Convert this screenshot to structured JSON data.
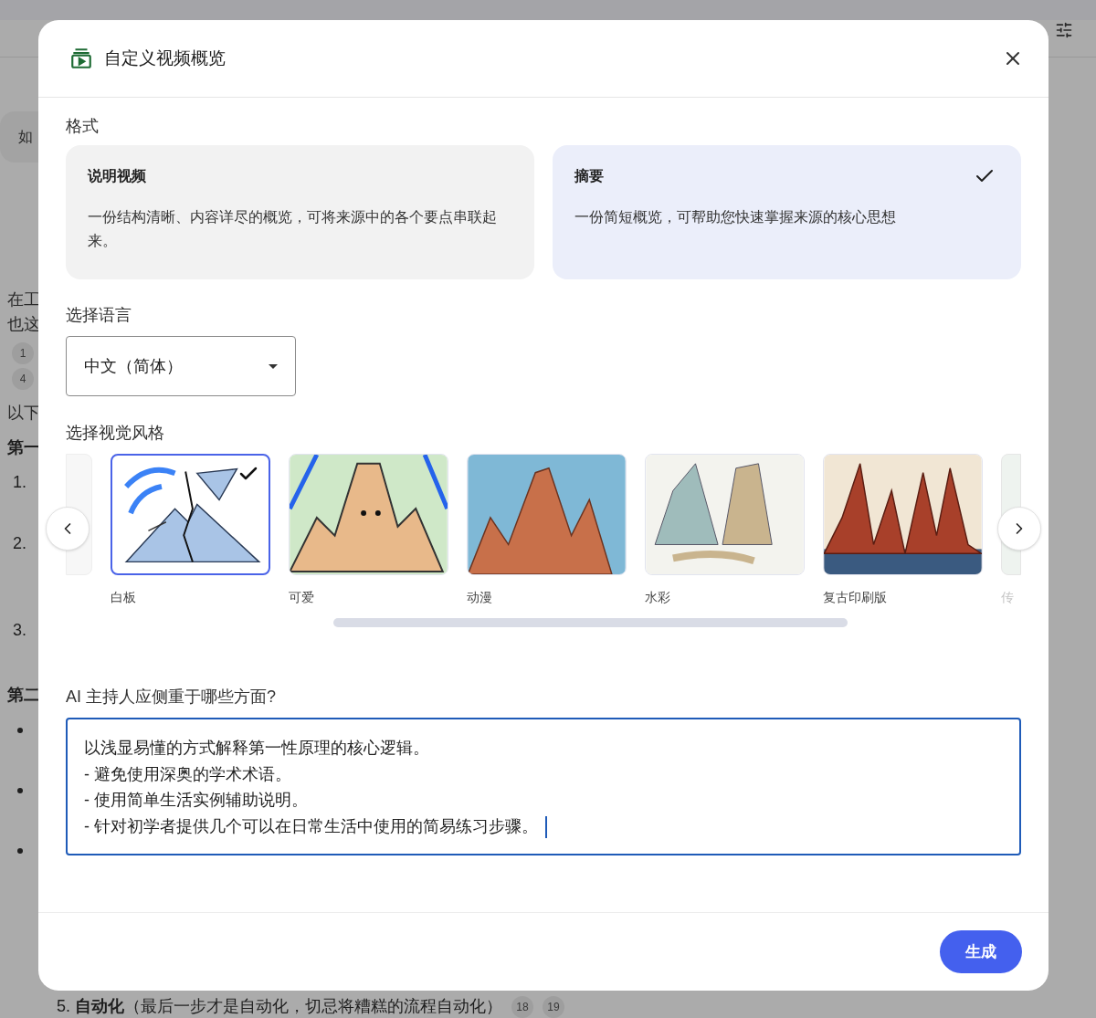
{
  "background_page": {
    "fragments": [
      {
        "kind": "bubble",
        "text": "如"
      },
      {
        "kind": "text",
        "text": "在工"
      },
      {
        "kind": "text",
        "text": "也这"
      },
      {
        "kind": "badge",
        "text": "1"
      },
      {
        "kind": "badge",
        "text": "4"
      },
      {
        "kind": "text",
        "text": "以下"
      },
      {
        "kind": "heading",
        "text": "第一"
      },
      {
        "kind": "number",
        "text": "1."
      },
      {
        "kind": "number",
        "text": "2."
      },
      {
        "kind": "number",
        "text": "3."
      },
      {
        "kind": "heading",
        "text": "第二"
      },
      {
        "kind": "bullet"
      },
      {
        "kind": "bullet"
      },
      {
        "kind": "bullet"
      }
    ],
    "bottom_line": {
      "number": "5.",
      "bold": "自动化",
      "rest": "（最后一步才是自动化，切忌将糟糕的流程自动化）",
      "badges": [
        "18",
        "19"
      ]
    }
  },
  "dialog": {
    "title": "自定义视频概览",
    "format_label": "格式",
    "formats": [
      {
        "title": "说明视频",
        "description": "一份结构清晰、内容详尽的概览，可将来源中的各个要点串联起来。",
        "selected": false
      },
      {
        "title": "摘要",
        "description": "一份简短概览，可帮助您快速掌握来源的核心思想",
        "selected": true
      }
    ],
    "language_label": "选择语言",
    "language_value": "中文（简体）",
    "style_label": "选择视觉风格",
    "styles": [
      {
        "kind": "whiteboard",
        "label": "白板",
        "selected": true
      },
      {
        "kind": "cute",
        "label": "可爱",
        "selected": false
      },
      {
        "kind": "anime",
        "label": "动漫",
        "selected": false
      },
      {
        "kind": "watercolor",
        "label": "水彩",
        "selected": false
      },
      {
        "kind": "retro",
        "label": "复古印刷版",
        "selected": false
      }
    ],
    "cut_style_label": "传",
    "focus_label": "AI 主持人应侧重于哪些方面?",
    "focus_value": "以浅显易懂的方式解释第一性原理的核心逻辑。\n- 避免使用深奥的学术术语。\n- 使用简单生活实例辅助说明。\n- 针对初学者提供几个可以在日常生活中使用的简易练习步骤。",
    "generate_button": "生成"
  }
}
